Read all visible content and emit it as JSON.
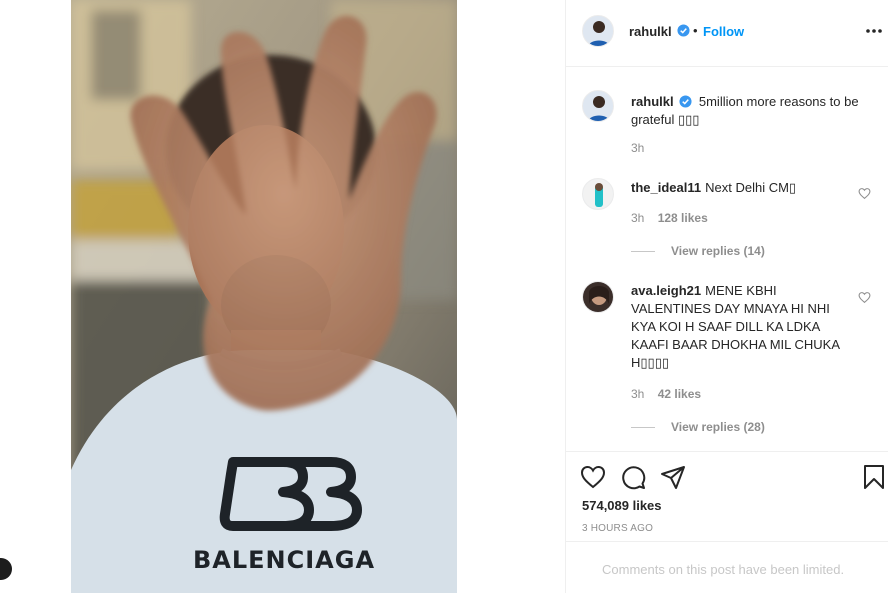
{
  "post": {
    "author": {
      "username": "rahulkl",
      "verified": true,
      "follow_label": "Follow",
      "separator": "•"
    },
    "more_icon": "more-horizontal-icon",
    "photo": {
      "shirt_brand_text": "BALENCIAGA",
      "colors": {
        "shirt": "#d6e0e8",
        "logo": "#1e2328",
        "skin": "#b58466"
      }
    },
    "caption": {
      "username": "rahulkl",
      "text": "5million more reasons to be grateful ▯▯▯",
      "time": "3h"
    },
    "comments": [
      {
        "username": "the_ideal11",
        "text": "Next Delhi CM▯",
        "time": "3h",
        "likes": "128 likes",
        "view_replies": "View replies (14)"
      },
      {
        "username": "ava.leigh21",
        "text": "MENE KBHI VALENTINES DAY MNAYA HI NHI KYA KOI H SAAF DILL KA LDKA KAAFI BAAR DHOKHA MIL CHUKA H▯▯▯▯",
        "time": "3h",
        "likes": "42 likes",
        "view_replies": "View replies (28)"
      }
    ],
    "actions": {
      "icons": [
        "heart-icon",
        "comment-icon",
        "share-icon",
        "bookmark-icon"
      ],
      "likes": "574,089 likes",
      "timestamp": "3 HOURS AGO"
    },
    "comments_limited": "Comments on this post have been limited.",
    "colors": {
      "accent": "#0095f6",
      "verified": "#3897f0",
      "muted": "#8e8e8e",
      "border": "#efefef"
    }
  }
}
